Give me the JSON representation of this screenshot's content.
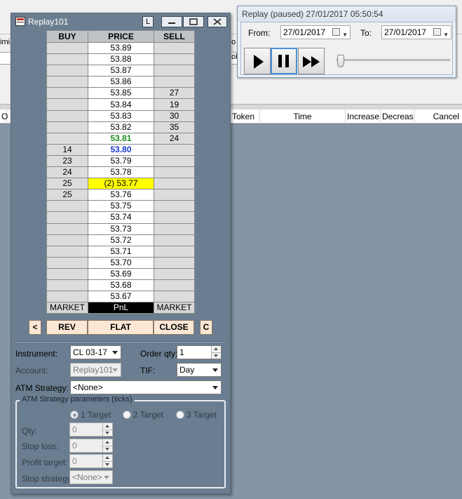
{
  "background": {
    "left_label": "imi",
    "mid_label": "o",
    "mid_field": "ol",
    "grid_columns": [
      "O",
      "Token",
      "Time",
      "Increase",
      "Decreas",
      "Cancel"
    ]
  },
  "replay": {
    "title": "Replay (paused) 27/01/2017 05:50:54",
    "from_label": "From:",
    "from_value": "27/01/2017",
    "to_label": "To:",
    "to_value": "27/01/2017",
    "speed_slider_level": 0.0
  },
  "dom": {
    "title": "Replay101",
    "l_button": "L",
    "headers": {
      "buy": "BUY",
      "price": "PRICE",
      "sell": "SELL"
    },
    "rows": [
      {
        "buy": "",
        "price": "53.89",
        "sell": "",
        "style": ""
      },
      {
        "buy": "",
        "price": "53.88",
        "sell": "",
        "style": ""
      },
      {
        "buy": "",
        "price": "53.87",
        "sell": "",
        "style": ""
      },
      {
        "buy": "",
        "price": "53.86",
        "sell": "",
        "style": ""
      },
      {
        "buy": "",
        "price": "53.85",
        "sell": "27",
        "style": ""
      },
      {
        "buy": "",
        "price": "53.84",
        "sell": "19",
        "style": ""
      },
      {
        "buy": "",
        "price": "53.83",
        "sell": "30",
        "style": ""
      },
      {
        "buy": "",
        "price": "53.82",
        "sell": "35",
        "style": ""
      },
      {
        "buy": "",
        "price": "53.81",
        "sell": "24",
        "style": "last"
      },
      {
        "buy": "14",
        "price": "53.80",
        "sell": "",
        "style": "cur"
      },
      {
        "buy": "23",
        "price": "53.79",
        "sell": "",
        "style": ""
      },
      {
        "buy": "24",
        "price": "53.78",
        "sell": "",
        "style": ""
      },
      {
        "buy": "25",
        "price": "(2) 53.77",
        "sell": "",
        "style": "pos"
      },
      {
        "buy": "25",
        "price": "53.76",
        "sell": "",
        "style": ""
      },
      {
        "buy": "",
        "price": "53.75",
        "sell": "",
        "style": ""
      },
      {
        "buy": "",
        "price": "53.74",
        "sell": "",
        "style": ""
      },
      {
        "buy": "",
        "price": "53.73",
        "sell": "",
        "style": ""
      },
      {
        "buy": "",
        "price": "53.72",
        "sell": "",
        "style": ""
      },
      {
        "buy": "",
        "price": "53.71",
        "sell": "",
        "style": ""
      },
      {
        "buy": "",
        "price": "53.70",
        "sell": "",
        "style": ""
      },
      {
        "buy": "",
        "price": "53.69",
        "sell": "",
        "style": ""
      },
      {
        "buy": "",
        "price": "53.68",
        "sell": "",
        "style": ""
      },
      {
        "buy": "",
        "price": "53.67",
        "sell": "",
        "style": ""
      }
    ],
    "footer": {
      "buy_market": "MARKET",
      "pnl": "PnL",
      "sell_market": "MARKET"
    },
    "buttons": {
      "left": "<",
      "rev": "REV",
      "flat": "FLAT",
      "close": "CLOSE",
      "c": "C"
    },
    "form": {
      "instrument_label": "Instrument:",
      "instrument_value": "CL 03-17",
      "order_qty_label": "Order qty:",
      "order_qty_value": "1",
      "account_label": "Account:",
      "account_value": "Replay101",
      "tif_label": "TIF:",
      "tif_value": "Day",
      "atm_label": "ATM Strategy:",
      "atm_value": "<None>",
      "atm_params_title": "ATM Strategy parameters (ticks)",
      "targets": [
        "1 Target",
        "2 Target",
        "3 Target"
      ],
      "qty_label": "Qty:",
      "qty_value": "0",
      "stop_loss_label": "Stop loss:",
      "stop_loss_value": "0",
      "profit_target_label": "Profit target:",
      "profit_target_value": "0",
      "stop_strategy_label": "Stop strategy:",
      "stop_strategy_value": "<None>"
    }
  },
  "colors": {
    "window_bg": "#6b7d90",
    "last_trade": "#1a8c1a",
    "current_price": "#1a3ad0",
    "position_highlight": "#ffff00",
    "action_button": "#fbe7d4"
  }
}
